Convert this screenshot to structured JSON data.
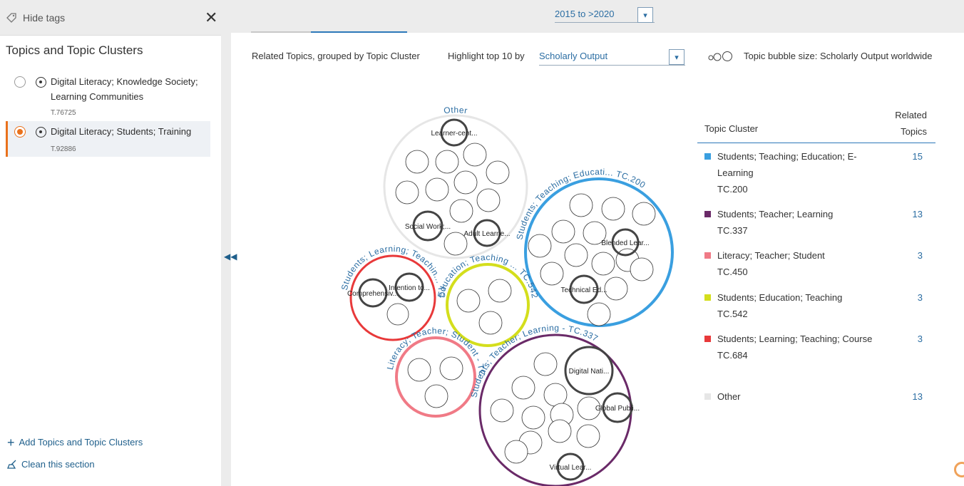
{
  "sidebar": {
    "hide_tags": "Hide tags",
    "section_title": "Topics and Topic Clusters",
    "topics": [
      {
        "label": "Digital Literacy; Knowledge Society; Learning Communities",
        "code": "T.76725",
        "selected": false
      },
      {
        "label": "Digital Literacy; Students; Training",
        "code": "T.92886",
        "selected": true
      }
    ],
    "add_link": "Add Topics and Topic Clusters",
    "clean_link": "Clean this section"
  },
  "topbar": {
    "date_range": "2015 to >2020"
  },
  "options": {
    "grouping_label": "Related Topics, grouped by Topic Cluster",
    "highlight_label": "Highlight top 10 by",
    "highlight_value": "Scholarly Output",
    "bubble_size_label": "Topic bubble size: Scholarly Output worldwide"
  },
  "legend": {
    "col_cluster": "Topic Cluster",
    "col_related": "Related Topics",
    "rows": [
      {
        "name": "Students; Teaching; Education; E-Learning",
        "code": "TC.200",
        "count": "15",
        "color": "#3a9fe0"
      },
      {
        "name": "Students; Teacher; Learning",
        "code": "TC.337",
        "count": "13",
        "color": "#6a2a68"
      },
      {
        "name": "Literacy; Teacher; Student",
        "code": "TC.450",
        "count": "3",
        "color": "#f07a86"
      },
      {
        "name": "Students; Education; Teaching",
        "code": "TC.542",
        "count": "3",
        "color": "#d4de1c"
      },
      {
        "name": "Students; Learning; Teaching; Course",
        "code": "TC.684",
        "count": "3",
        "color": "#e8393a"
      },
      {
        "name": "Other",
        "code": "",
        "count": "13",
        "color": "#e6e6e6"
      }
    ]
  },
  "chart": {
    "clusters": [
      {
        "id": "other",
        "label": "Other",
        "color": "#e6e6e6",
        "topic_labels": [
          "Learner-cent...",
          "Social Work;...",
          "Adult Learne..."
        ]
      },
      {
        "id": "tc200",
        "label": "Students; Teaching; Educati... TC.200",
        "color": "#3a9fe0",
        "topic_labels": [
          "Blended Lear...",
          "Technical Ed..."
        ]
      },
      {
        "id": "tc684",
        "label": "Students; Learning; Teachin... TC.684",
        "color": "#e8393a",
        "topic_labels": [
          "Intention to...",
          "Comprehensiv..."
        ]
      },
      {
        "id": "tc542",
        "label": "Education; Teaching ... TC.542",
        "color": "#d4de1c",
        "topic_labels": []
      },
      {
        "id": "tc450",
        "label": "Literacy; Teacher; Student - TC.450",
        "color": "#f07a86",
        "topic_labels": []
      },
      {
        "id": "tc337",
        "label": "Students; Teacher; Learning - TC.337",
        "color": "#6a2a68",
        "topic_labels": [
          "Digital Nati...",
          "Global Publi...",
          "Virtual Lear..."
        ]
      }
    ]
  }
}
